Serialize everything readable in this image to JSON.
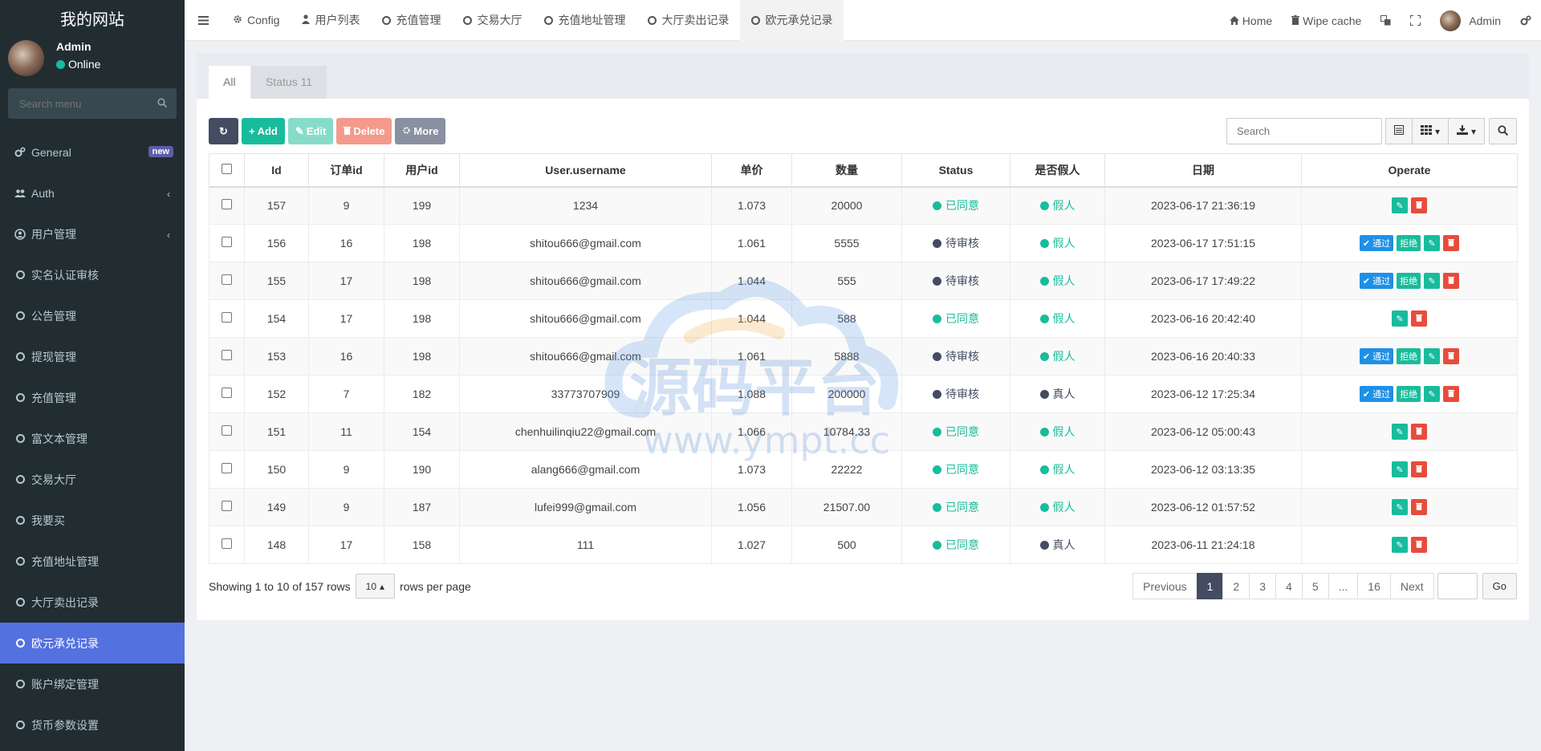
{
  "sidebar": {
    "brand": "我的网站",
    "user": {
      "name": "Admin",
      "status": "Online"
    },
    "search_placeholder": "Search menu",
    "items": [
      {
        "label": "General",
        "badge": "new"
      },
      {
        "label": "Auth"
      },
      {
        "label": "用户管理"
      },
      {
        "label": "实名认证审核"
      },
      {
        "label": "公告管理"
      },
      {
        "label": "提现管理"
      },
      {
        "label": "充值管理"
      },
      {
        "label": "富文本管理"
      },
      {
        "label": "交易大厅"
      },
      {
        "label": "我要买"
      },
      {
        "label": "充值地址管理"
      },
      {
        "label": "大厅卖出记录"
      },
      {
        "label": "欧元承兑记录"
      },
      {
        "label": "账户绑定管理"
      },
      {
        "label": "货币参数设置"
      }
    ]
  },
  "topbar": {
    "tabs": [
      "Config",
      "用户列表",
      "充值管理",
      "交易大厅",
      "充值地址管理",
      "大厅卖出记录",
      "欧元承兑记录"
    ],
    "home": "Home",
    "wipe": "Wipe cache",
    "admin": "Admin"
  },
  "panel": {
    "tabs": [
      "All",
      "Status 11"
    ],
    "toolbar": {
      "add": "Add",
      "edit": "Edit",
      "delete": "Delete",
      "more": "More"
    },
    "search_placeholder": "Search"
  },
  "table": {
    "headers": [
      "Id",
      "订单id",
      "用户id",
      "User.username",
      "单价",
      "数量",
      "Status",
      "是否假人",
      "日期",
      "Operate"
    ],
    "rows": [
      {
        "id": "157",
        "order": "9",
        "uid": "199",
        "username": "1234",
        "price": "1.073",
        "qty": "20000",
        "status": "已同意",
        "fake": "假人",
        "date": "2023-06-17 21:36:19"
      },
      {
        "id": "156",
        "order": "16",
        "uid": "198",
        "username": "shitou666@gmail.com",
        "price": "1.061",
        "qty": "5555",
        "status": "待审核",
        "fake": "假人",
        "date": "2023-06-17 17:51:15"
      },
      {
        "id": "155",
        "order": "17",
        "uid": "198",
        "username": "shitou666@gmail.com",
        "price": "1.044",
        "qty": "555",
        "status": "待审核",
        "fake": "假人",
        "date": "2023-06-17 17:49:22"
      },
      {
        "id": "154",
        "order": "17",
        "uid": "198",
        "username": "shitou666@gmail.com",
        "price": "1.044",
        "qty": "588",
        "status": "已同意",
        "fake": "假人",
        "date": "2023-06-16 20:42:40"
      },
      {
        "id": "153",
        "order": "16",
        "uid": "198",
        "username": "shitou666@gmail.com",
        "price": "1.061",
        "qty": "5888",
        "status": "待审核",
        "fake": "假人",
        "date": "2023-06-16 20:40:33"
      },
      {
        "id": "152",
        "order": "7",
        "uid": "182",
        "username": "33773707909",
        "price": "1.088",
        "qty": "200000",
        "status": "待审核",
        "fake": "真人",
        "date": "2023-06-12 17:25:34"
      },
      {
        "id": "151",
        "order": "11",
        "uid": "154",
        "username": "chenhuilinqiu22@gmail.com",
        "price": "1.066",
        "qty": "10784.33",
        "status": "已同意",
        "fake": "假人",
        "date": "2023-06-12 05:00:43"
      },
      {
        "id": "150",
        "order": "9",
        "uid": "190",
        "username": "alang666@gmail.com",
        "price": "1.073",
        "qty": "22222",
        "status": "已同意",
        "fake": "假人",
        "date": "2023-06-12 03:13:35"
      },
      {
        "id": "149",
        "order": "9",
        "uid": "187",
        "username": "lufei999@gmail.com",
        "price": "1.056",
        "qty": "21507.00",
        "status": "已同意",
        "fake": "假人",
        "date": "2023-06-12 01:57:52"
      },
      {
        "id": "148",
        "order": "17",
        "uid": "158",
        "username": "111",
        "price": "1.027",
        "qty": "500",
        "status": "已同意",
        "fake": "真人",
        "date": "2023-06-11 21:24:18"
      }
    ],
    "op_pass": "通过",
    "op_reject": "拒绝"
  },
  "footer": {
    "showing": "Showing 1 to 10 of 157 rows",
    "page_size": "10",
    "rows_per_page": "rows per page",
    "pages": [
      "Previous",
      "1",
      "2",
      "3",
      "4",
      "5",
      "...",
      "16",
      "Next"
    ],
    "go": "Go"
  },
  "watermark": {
    "title": "源码平台",
    "url": "www.ympt.cc"
  },
  "colors": {
    "sidebar": "#222d32",
    "active": "#5471e0",
    "green": "#18bc9c",
    "dark": "#444c62",
    "red": "#e74c3c",
    "blue": "#1e90e6"
  }
}
